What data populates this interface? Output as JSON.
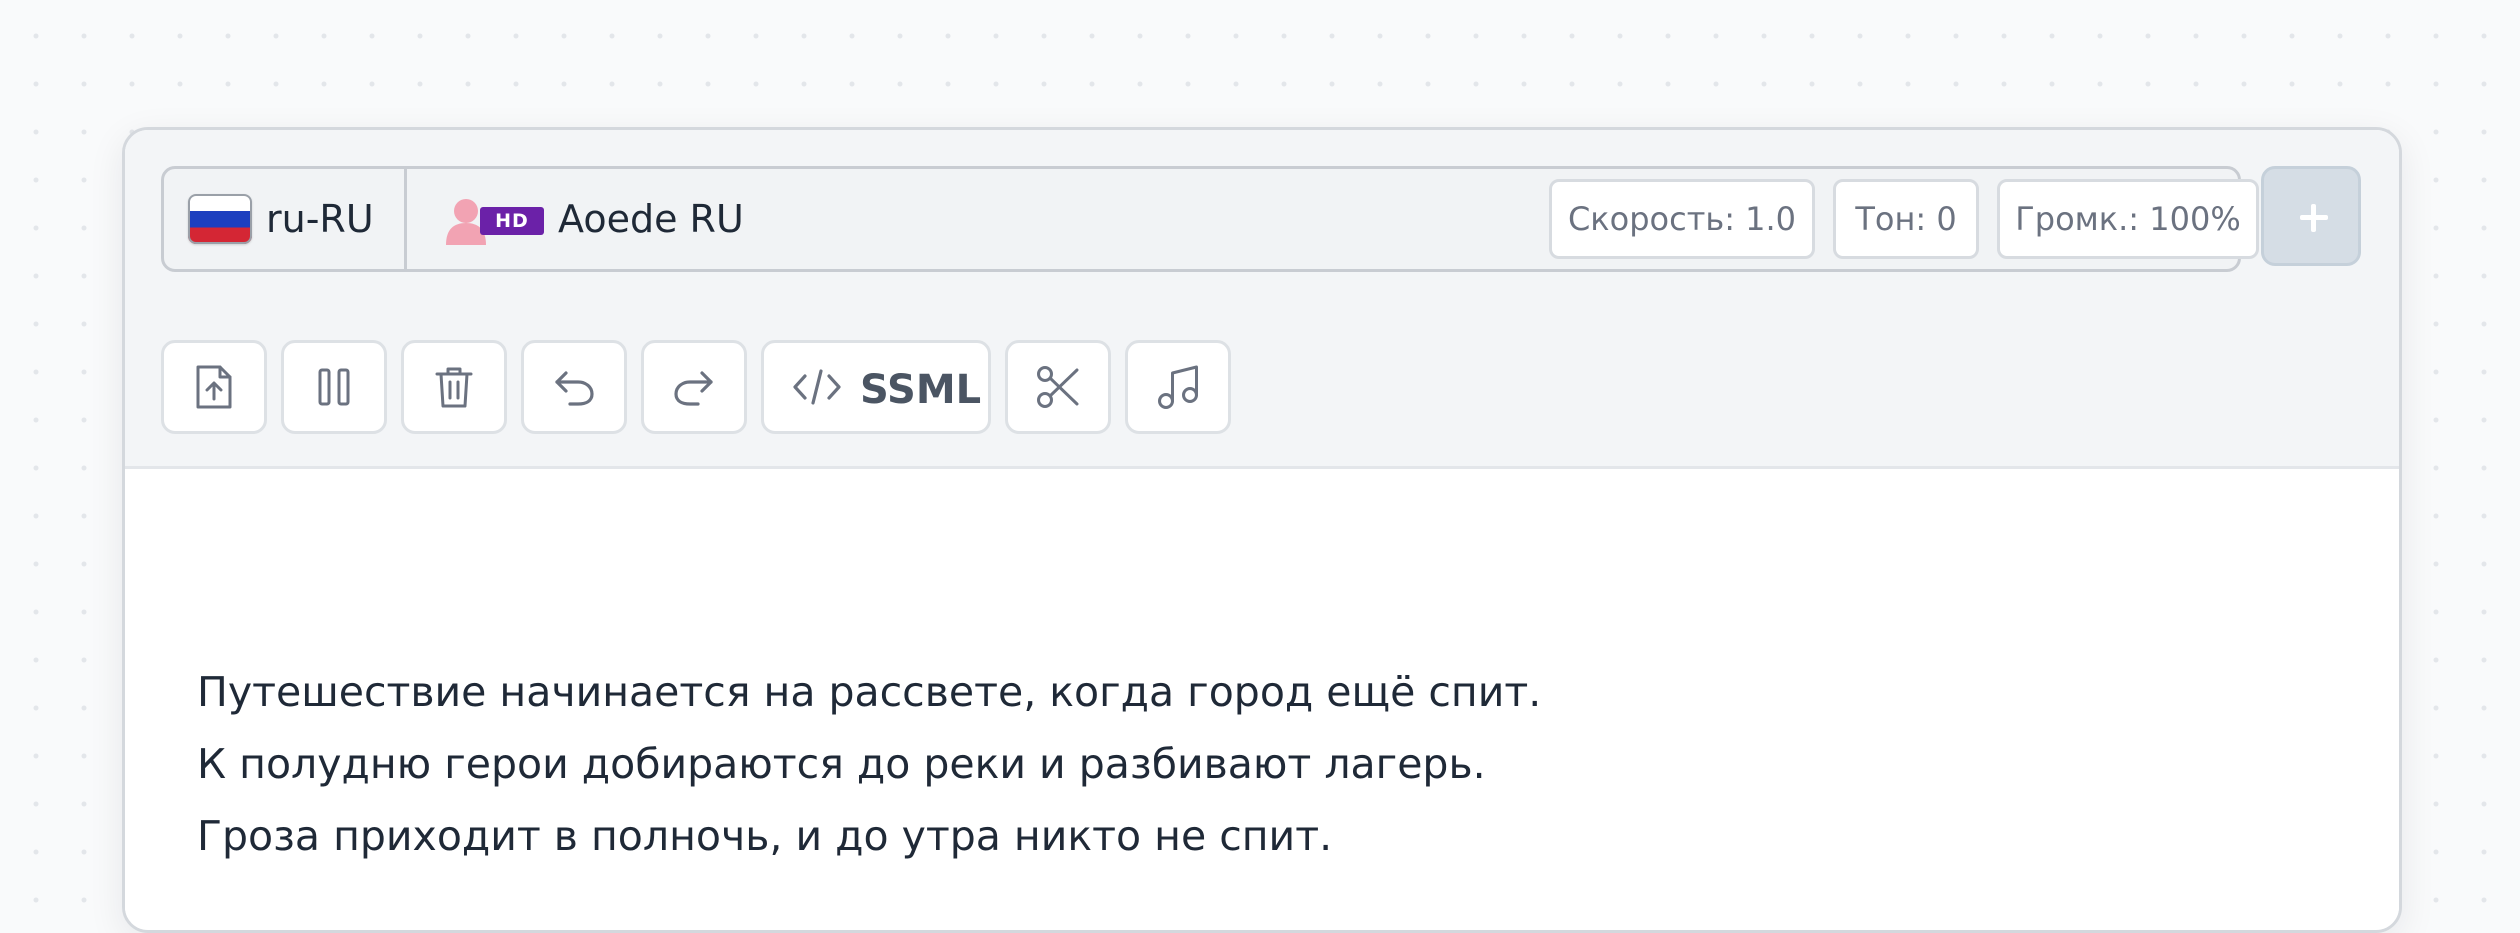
{
  "voice_bar": {
    "language_code": "ru-RU",
    "flag": "russia-flag",
    "voice_badge": "HD",
    "voice_name": "Aoede RU",
    "voice_icon": "female-person-icon",
    "speed_label": "Скорость: 1.0",
    "pitch_label": "Тон: 0",
    "volume_label": "Громк.: 100%",
    "add_icon": "plus-icon"
  },
  "toolbar": {
    "icons": [
      "upload-file-icon",
      "pause-icon",
      "trash-icon",
      "undo-icon",
      "redo-icon",
      "code-icon",
      "scissors-icon",
      "music-note-icon"
    ],
    "ssml_label": "SSML"
  },
  "editor": {
    "lines": [
      "Путешествие начинается на рассвете, когда город ещё спит.",
      "К полудню герои добираются до реки и разбивают лагерь.",
      "Гроза приходит в полночь, и до утра никто не спит."
    ]
  },
  "colors": {
    "hd_badge": "#6b21a8",
    "person_icon": "#f2a3b3",
    "add_button": "#d5dde5",
    "text": "#1f2937"
  }
}
